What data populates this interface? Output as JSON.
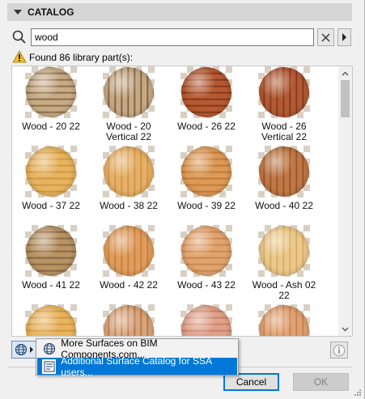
{
  "catalog": {
    "title": "CATALOG"
  },
  "search": {
    "value": "wood",
    "placeholder": ""
  },
  "status": {
    "found_text": "Found 86 library part(s):"
  },
  "items": [
    {
      "label": "Wood - 20 22",
      "base": "#c7ab86",
      "grain": "#7a5a3a"
    },
    {
      "label": "Wood - 20\nVertical 22",
      "base": "#c6aa86",
      "grain": "#6e4e32"
    },
    {
      "label": "Wood - 26 22",
      "base": "#b55a32",
      "grain": "#7a2e14"
    },
    {
      "label": "Wood - 26\nVertical 22",
      "base": "#b35a35",
      "grain": "#7b3217"
    },
    {
      "label": "Wood - 37 22",
      "base": "#e6b45e",
      "grain": "#c98f3e"
    },
    {
      "label": "Wood - 38 22",
      "base": "#e6b067",
      "grain": "#c98c45"
    },
    {
      "label": "Wood - 39 22",
      "base": "#dc9a55",
      "grain": "#b97038"
    },
    {
      "label": "Wood - 40 22",
      "base": "#c07845",
      "grain": "#8c4d28"
    },
    {
      "label": "Wood - 41 22",
      "base": "#b89363",
      "grain": "#7a5a3a"
    },
    {
      "label": "Wood - 42 22",
      "base": "#e09d5c",
      "grain": "#bf773c"
    },
    {
      "label": "Wood - 43 22",
      "base": "#e1a46e",
      "grain": "#c17f4c"
    },
    {
      "label": "Wood - Ash 02\n22",
      "base": "#ecc98a",
      "grain": "#cfa563"
    },
    {
      "label": "",
      "base": "#e8b45c",
      "grain": "#c98f3e"
    },
    {
      "label": "",
      "base": "#d9a57a",
      "grain": "#a86a45"
    },
    {
      "label": "",
      "base": "#e0a08a",
      "grain": "#bd7a60"
    },
    {
      "label": "",
      "base": "#e0a070",
      "grain": "#c07a48"
    }
  ],
  "menu": {
    "item1": "More Surfaces on BIM Components.com...",
    "item2": "Additional Surface Catalog for SSA users..."
  },
  "buttons": {
    "cancel": "Cancel",
    "ok": "OK"
  },
  "icons": {
    "search": "search-icon",
    "clear": "close-icon",
    "more": "chevron-right-icon",
    "warning": "warning-icon",
    "globe": "globe-icon",
    "info": "info-icon",
    "catalog": "catalog-icon"
  },
  "colors": {
    "accent": "#0078d7",
    "header": "#d6d6d6",
    "warning": "#f4c020"
  }
}
